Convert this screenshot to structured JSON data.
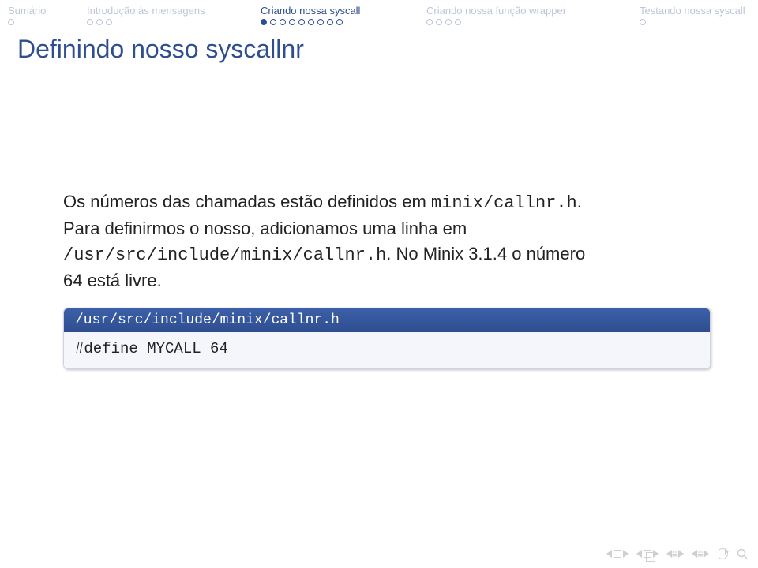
{
  "nav": {
    "sections": [
      {
        "label": "Sumário",
        "active": false,
        "dots": 1,
        "current": -1
      },
      {
        "label": "Introdução às mensagens",
        "active": false,
        "dots": 3,
        "current": -1
      },
      {
        "label": "Criando nossa syscall",
        "active": true,
        "dots": 9,
        "current": 0
      },
      {
        "label": "Criando nossa função wrapper",
        "active": false,
        "dots": 4,
        "current": -1
      },
      {
        "label": "Testando nossa syscall",
        "active": false,
        "dots": 1,
        "current": -1
      }
    ]
  },
  "title": "Definindo nosso syscallnr",
  "body": {
    "line1_a": "Os números das chamadas estão definidos em ",
    "line1_tt": "minix/callnr.h",
    "line1_c": ".",
    "line2_a": "Para definirmos o nosso, adicionamos uma linha em",
    "line3_tt": "/usr/src/include/minix/callnr.h",
    "line3_b": ". No Minix 3.1.4 o número",
    "line4": "64 está livre."
  },
  "block": {
    "title": "/usr/src/include/minix/callnr.h",
    "code": "#define MYCALL 64"
  }
}
